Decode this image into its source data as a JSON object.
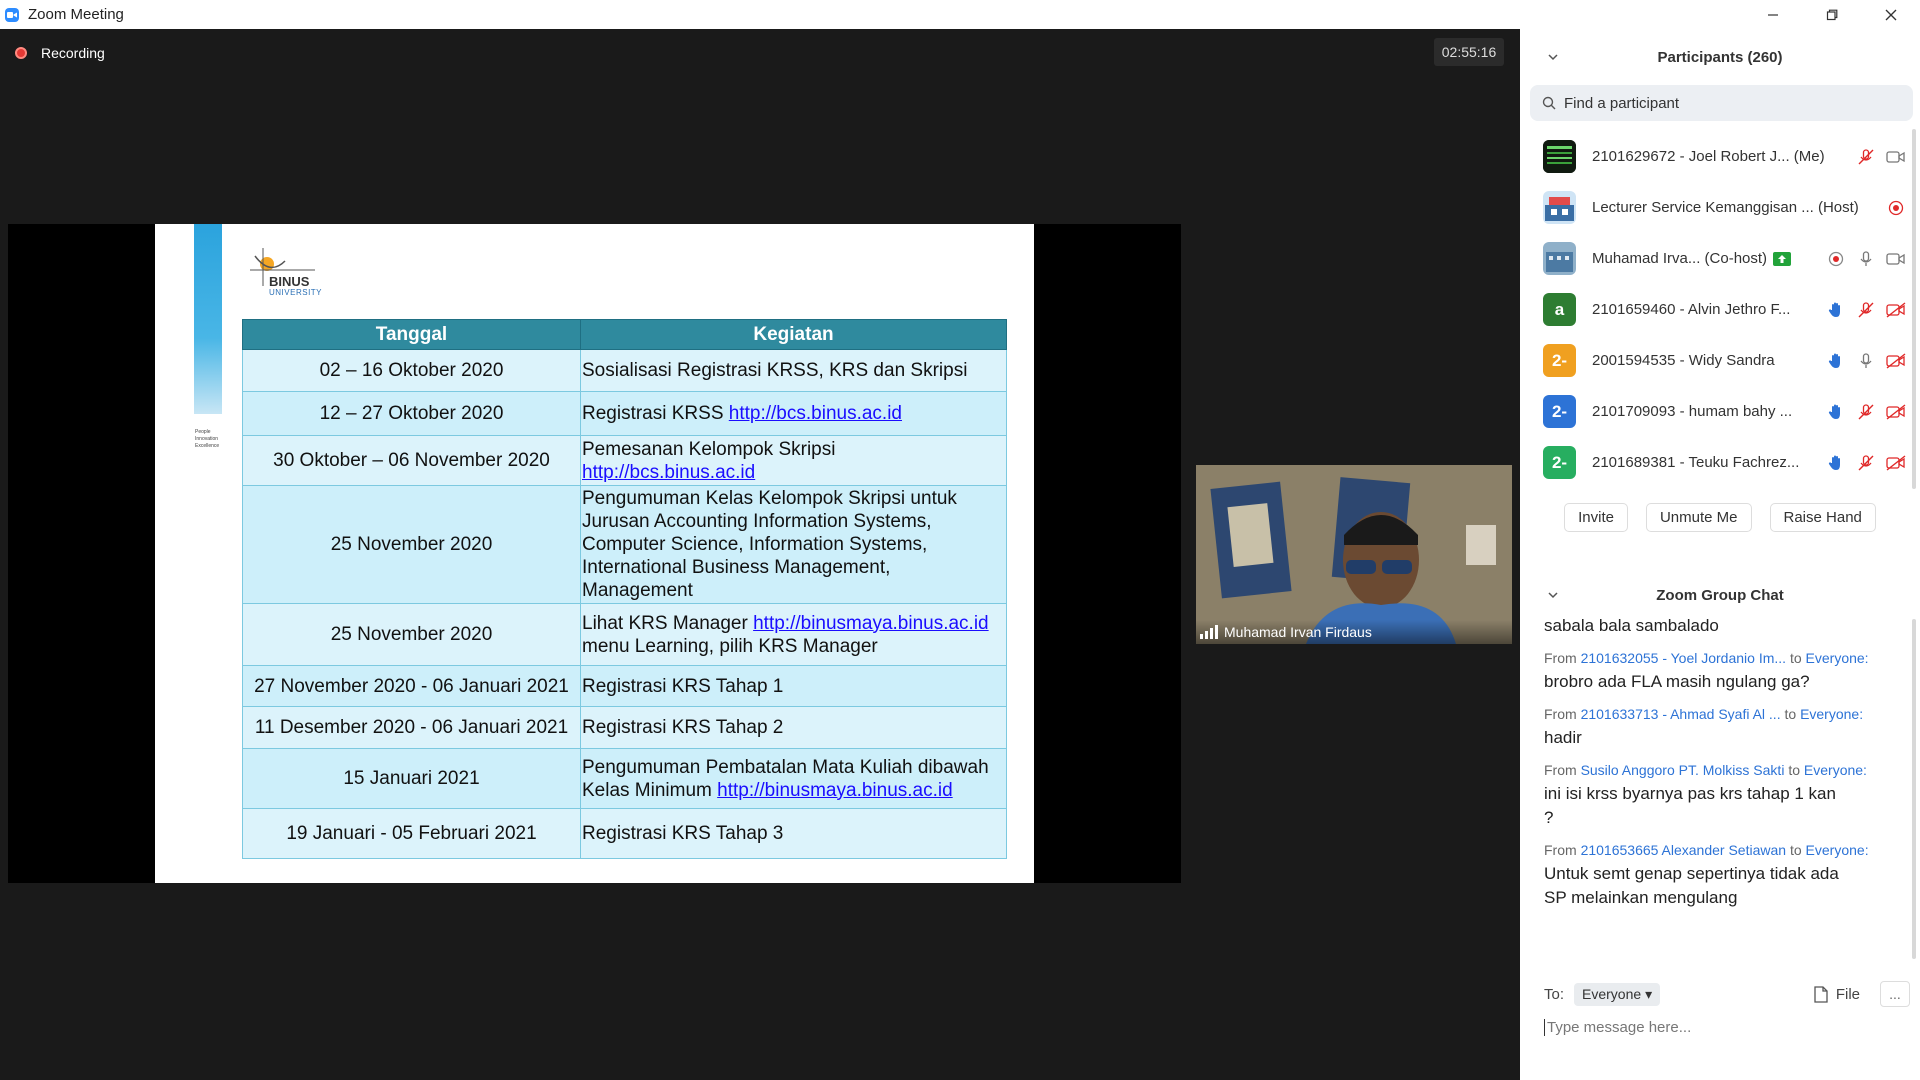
{
  "window": {
    "title": "Zoom Meeting"
  },
  "meeting": {
    "recording_label": "Recording",
    "timer": "02:55:16"
  },
  "slide": {
    "logo_name": "BINUS",
    "logo_sub": "UNIVERSITY",
    "strip_text": "People Innovation Excellence",
    "headers": [
      "Tanggal",
      "Kegiatan"
    ],
    "rows": [
      {
        "date": "02 – 16 Oktober 2020",
        "activity": "Sosialisasi Registrasi KRSS, KRS dan Skripsi",
        "link": ""
      },
      {
        "date": "12 – 27 Oktober 2020",
        "activity": "Registrasi KRSS ",
        "link": "http://bcs.binus.ac.id"
      },
      {
        "date": "30 Oktober – 06 November 2020",
        "activity": "Pemesanan Kelompok Skripsi",
        "link": "http://bcs.binus.ac.id"
      },
      {
        "date": "25 November 2020",
        "activity": "Pengumuman Kelas Kelompok Skripsi untuk Jurusan Accounting Information Systems, Computer Science, Information Systems, International Business Management, Management",
        "link": ""
      },
      {
        "date": "25 November 2020",
        "activity": "Lihat KRS Manager ",
        "link": "http://binusmaya.binus.ac.id",
        "activity_after": "menu Learning, pilih KRS Manager"
      },
      {
        "date": "27 November 2020 - 06 Januari 2021",
        "activity": "Registrasi KRS Tahap 1",
        "link": ""
      },
      {
        "date": "11 Desember 2020 - 06 Januari 2021",
        "activity": "Registrasi KRS Tahap 2",
        "link": ""
      },
      {
        "date": "15 Januari 2021",
        "activity": "Pengumuman Pembatalan Mata Kuliah dibawah Kelas Minimum ",
        "link": "http://binusmaya.binus.ac.id"
      },
      {
        "date": "19 Januari - 05 Februari 2021",
        "activity": "Registrasi KRS Tahap 3",
        "link": ""
      }
    ]
  },
  "camera": {
    "name": "Muhamad Irvan Firdaus"
  },
  "participants": {
    "title": "Participants (260)",
    "search_placeholder": "Find a participant",
    "items": [
      {
        "name": "2101629672 - Joel Robert J...  (Me)",
        "avatar": "",
        "color": "#1b2a1b"
      },
      {
        "name": "Lecturer Service Kemanggisan ...  (Host)",
        "avatar": "",
        "color": "#3a6ea5"
      },
      {
        "name": "Muhamad Irva...  (Co-host)",
        "avatar": "",
        "color": "#6a8fb0"
      },
      {
        "name": "2101659460 - Alvin Jethro F...",
        "avatar": "a",
        "color": "#2e7d32"
      },
      {
        "name": "2001594535 - Widy Sandra",
        "avatar": "2-",
        "color": "#f0a020"
      },
      {
        "name": "2101709093 - humam bahy ...",
        "avatar": "2-",
        "color": "#2d73d6"
      },
      {
        "name": "2101689381 - Teuku Fachrez...",
        "avatar": "2-",
        "color": "#27ae60"
      }
    ],
    "buttons": [
      "Invite",
      "Unmute Me",
      "Raise Hand"
    ]
  },
  "chat": {
    "title": "Zoom Group Chat",
    "messages": [
      {
        "from": "",
        "to": "",
        "text": "sabala bala sambalado"
      },
      {
        "from": "2101632055 - Yoel Jordanio Im...",
        "to": "Everyone:",
        "text": "brobro ada FLA masih ngulang ga?"
      },
      {
        "from": "2101633713 - Ahmad Syafi Al ...",
        "to": "Everyone:",
        "text": "hadir"
      },
      {
        "from": "Susilo Anggoro PT. Molkiss Sakti",
        "to": "Everyone:",
        "text": "ini isi krss byarnya pas krs tahap 1 kan ?"
      },
      {
        "from": "2101653665 Alexander Setiawan",
        "to": "Everyone:",
        "text": "Untuk semt genap sepertinya tidak ada SP melainkan mengulang"
      }
    ],
    "from_label": "From",
    "to_label": "to",
    "to_prefix": "To:",
    "recipient": "Everyone",
    "file_label": "File",
    "more_label": "...",
    "input_placeholder": "Type message here..."
  }
}
